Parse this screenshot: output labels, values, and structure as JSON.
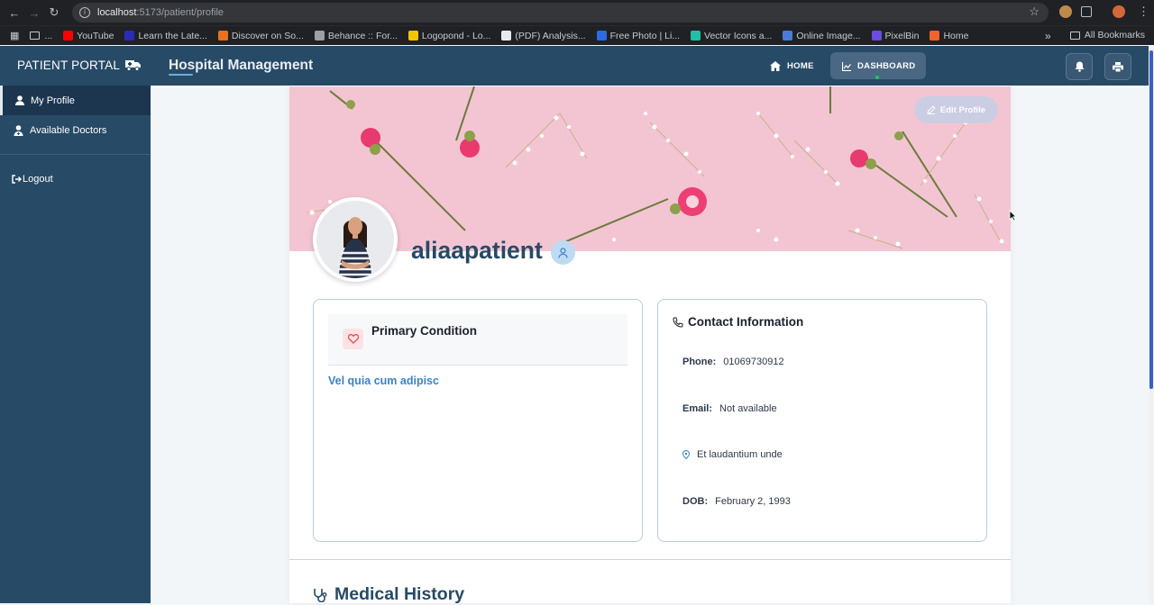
{
  "browser": {
    "url_host": "localhost",
    "url_path": ":5173/patient/profile",
    "bookmarks": [
      {
        "label": "...",
        "color": "#8a8a8a"
      },
      {
        "label": "YouTube",
        "color": "#ff0000"
      },
      {
        "label": "Learn the Late...",
        "color": "#2b2bb5"
      },
      {
        "label": "Discover on So...",
        "color": "#e8711c"
      },
      {
        "label": "Behance :: For...",
        "color": "#9aa0a6"
      },
      {
        "label": "Logopond - Lo...",
        "color": "#f5c400"
      },
      {
        "label": "(PDF) Analysis...",
        "color": "#e8eaed"
      },
      {
        "label": "Free Photo | Li...",
        "color": "#2d6be4"
      },
      {
        "label": "Vector Icons a...",
        "color": "#21c0a6"
      },
      {
        "label": "Online Image...",
        "color": "#4b7bd6"
      },
      {
        "label": "PixelBin",
        "color": "#6b4be0"
      },
      {
        "label": "Home",
        "color": "#f0642c"
      }
    ],
    "more_bookmarks": "»",
    "all_bookmarks": "All Bookmarks"
  },
  "header": {
    "brand": "PATIENT PORTAL",
    "title": "Hospital Management",
    "nav": [
      {
        "label": "HOME",
        "icon": "home-icon"
      },
      {
        "label": "DASHBOARD",
        "icon": "chart-line-icon"
      }
    ]
  },
  "sidebar": {
    "items": [
      {
        "label": "My Profile",
        "icon": "user-icon"
      },
      {
        "label": "Available Doctors",
        "icon": "user-doctor-icon"
      }
    ],
    "logout": "Logout"
  },
  "profile": {
    "edit_label": "Edit Profile",
    "username": "aliaapatient",
    "primary_condition_title": "Primary Condition",
    "primary_condition_value": "Vel quia cum adipisc",
    "contact_title": "Contact Information",
    "phone_label": "Phone:",
    "phone": "01069730912",
    "email_label": "Email:",
    "email": "Not available",
    "address": "Et laudantium unde",
    "dob_label": "DOB:",
    "dob": "February 2, 1993",
    "medical_history_title": "Medical History"
  },
  "colors": {
    "primary": "#274a66",
    "accent_blue": "#3b82c4",
    "banner_pink": "#f2c6d3",
    "status_dot": "#22c55e"
  }
}
